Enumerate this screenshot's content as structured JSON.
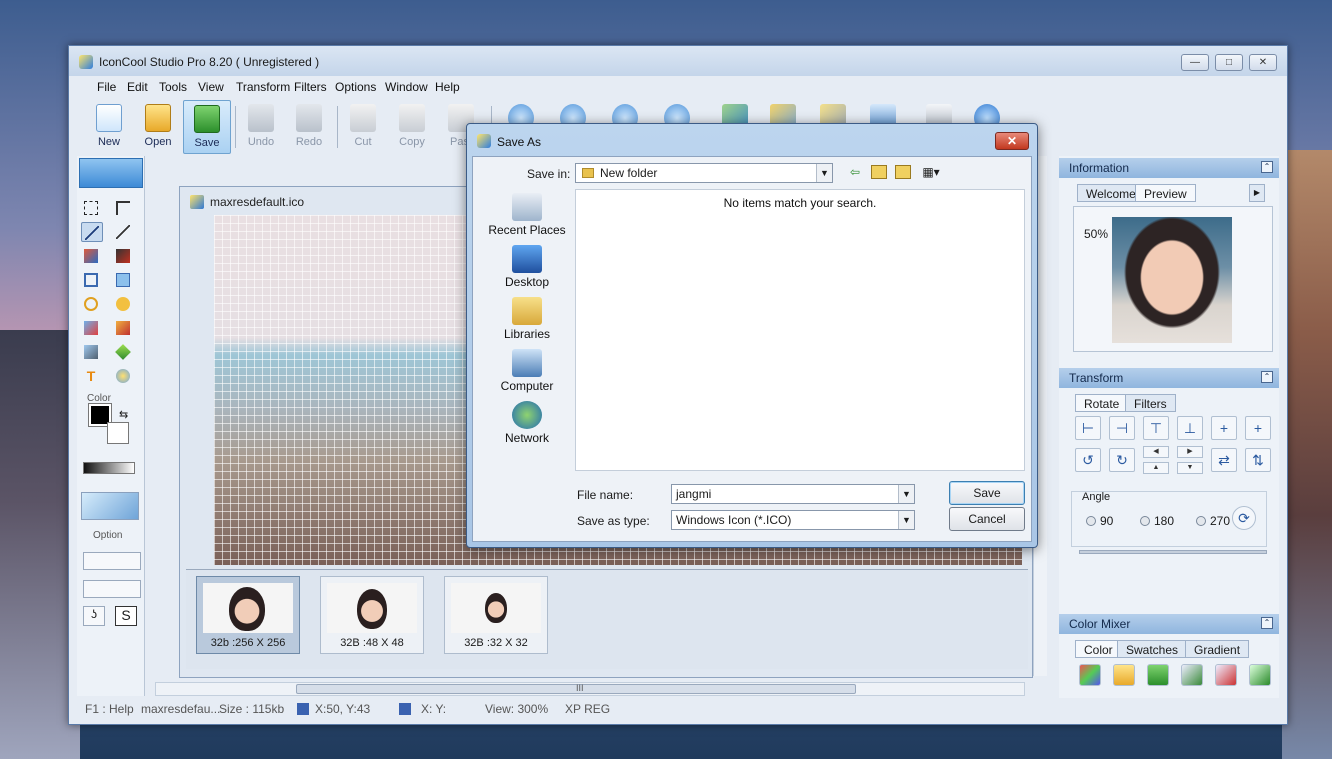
{
  "app": {
    "title": "IconCool Studio Pro 8.20 ( Unregistered )",
    "window_controls": {
      "minimize": "—",
      "maximize": "□",
      "close": "✕"
    }
  },
  "menu": [
    "File",
    "Edit",
    "Tools",
    "View",
    "Transform",
    "Filters",
    "Options",
    "Window",
    "Help"
  ],
  "toolbar": {
    "new": "New",
    "open": "Open",
    "save": "Save",
    "undo": "Undo",
    "redo": "Redo",
    "cut": "Cut",
    "copy": "Copy",
    "paste": "Past"
  },
  "tool_panel": {
    "color_label": "Color",
    "option_label": "Option"
  },
  "document": {
    "title": "maxresdefault.ico",
    "thumbnails": [
      "32b :256 X 256",
      "32B :48 X 48",
      "32B :32 X 32"
    ],
    "hscroll_grip": "III"
  },
  "right_panel": {
    "information": {
      "header": "Information",
      "tabs": [
        "Welcome",
        "Preview"
      ],
      "zoom": "50%"
    },
    "transform": {
      "header": "Transform",
      "tabs": [
        "Rotate",
        "Filters"
      ],
      "angle_label": "Angle",
      "angles": [
        "90",
        "180",
        "270"
      ]
    },
    "color_mixer": {
      "header": "Color Mixer",
      "tabs": [
        "Color",
        "Swatches",
        "Gradient"
      ]
    }
  },
  "status": {
    "help": "F1 : Help",
    "file": "maxresdefau...",
    "size": "Size : 115kb",
    "xy": "X:50, Y:43",
    "sel": "X:  Y:",
    "view": "View: 300%",
    "mode": "XP REG"
  },
  "dialog": {
    "title": "Save As",
    "close_glyph": "✕",
    "save_in_label": "Save in:",
    "save_in_value": "New folder",
    "places": [
      "Recent Places",
      "Desktop",
      "Libraries",
      "Computer",
      "Network"
    ],
    "empty_message": "No items match your search.",
    "file_name_label": "File name:",
    "file_name_value": "jangmi",
    "save_as_type_label": "Save as type:",
    "save_as_type_value": "Windows Icon (*.ICO)",
    "save_button": "Save",
    "cancel_button": "Cancel"
  },
  "colors": {
    "accent": "#2d7de0",
    "dialog_frame": "#a9c6e6",
    "close_red": "#c2381f"
  }
}
